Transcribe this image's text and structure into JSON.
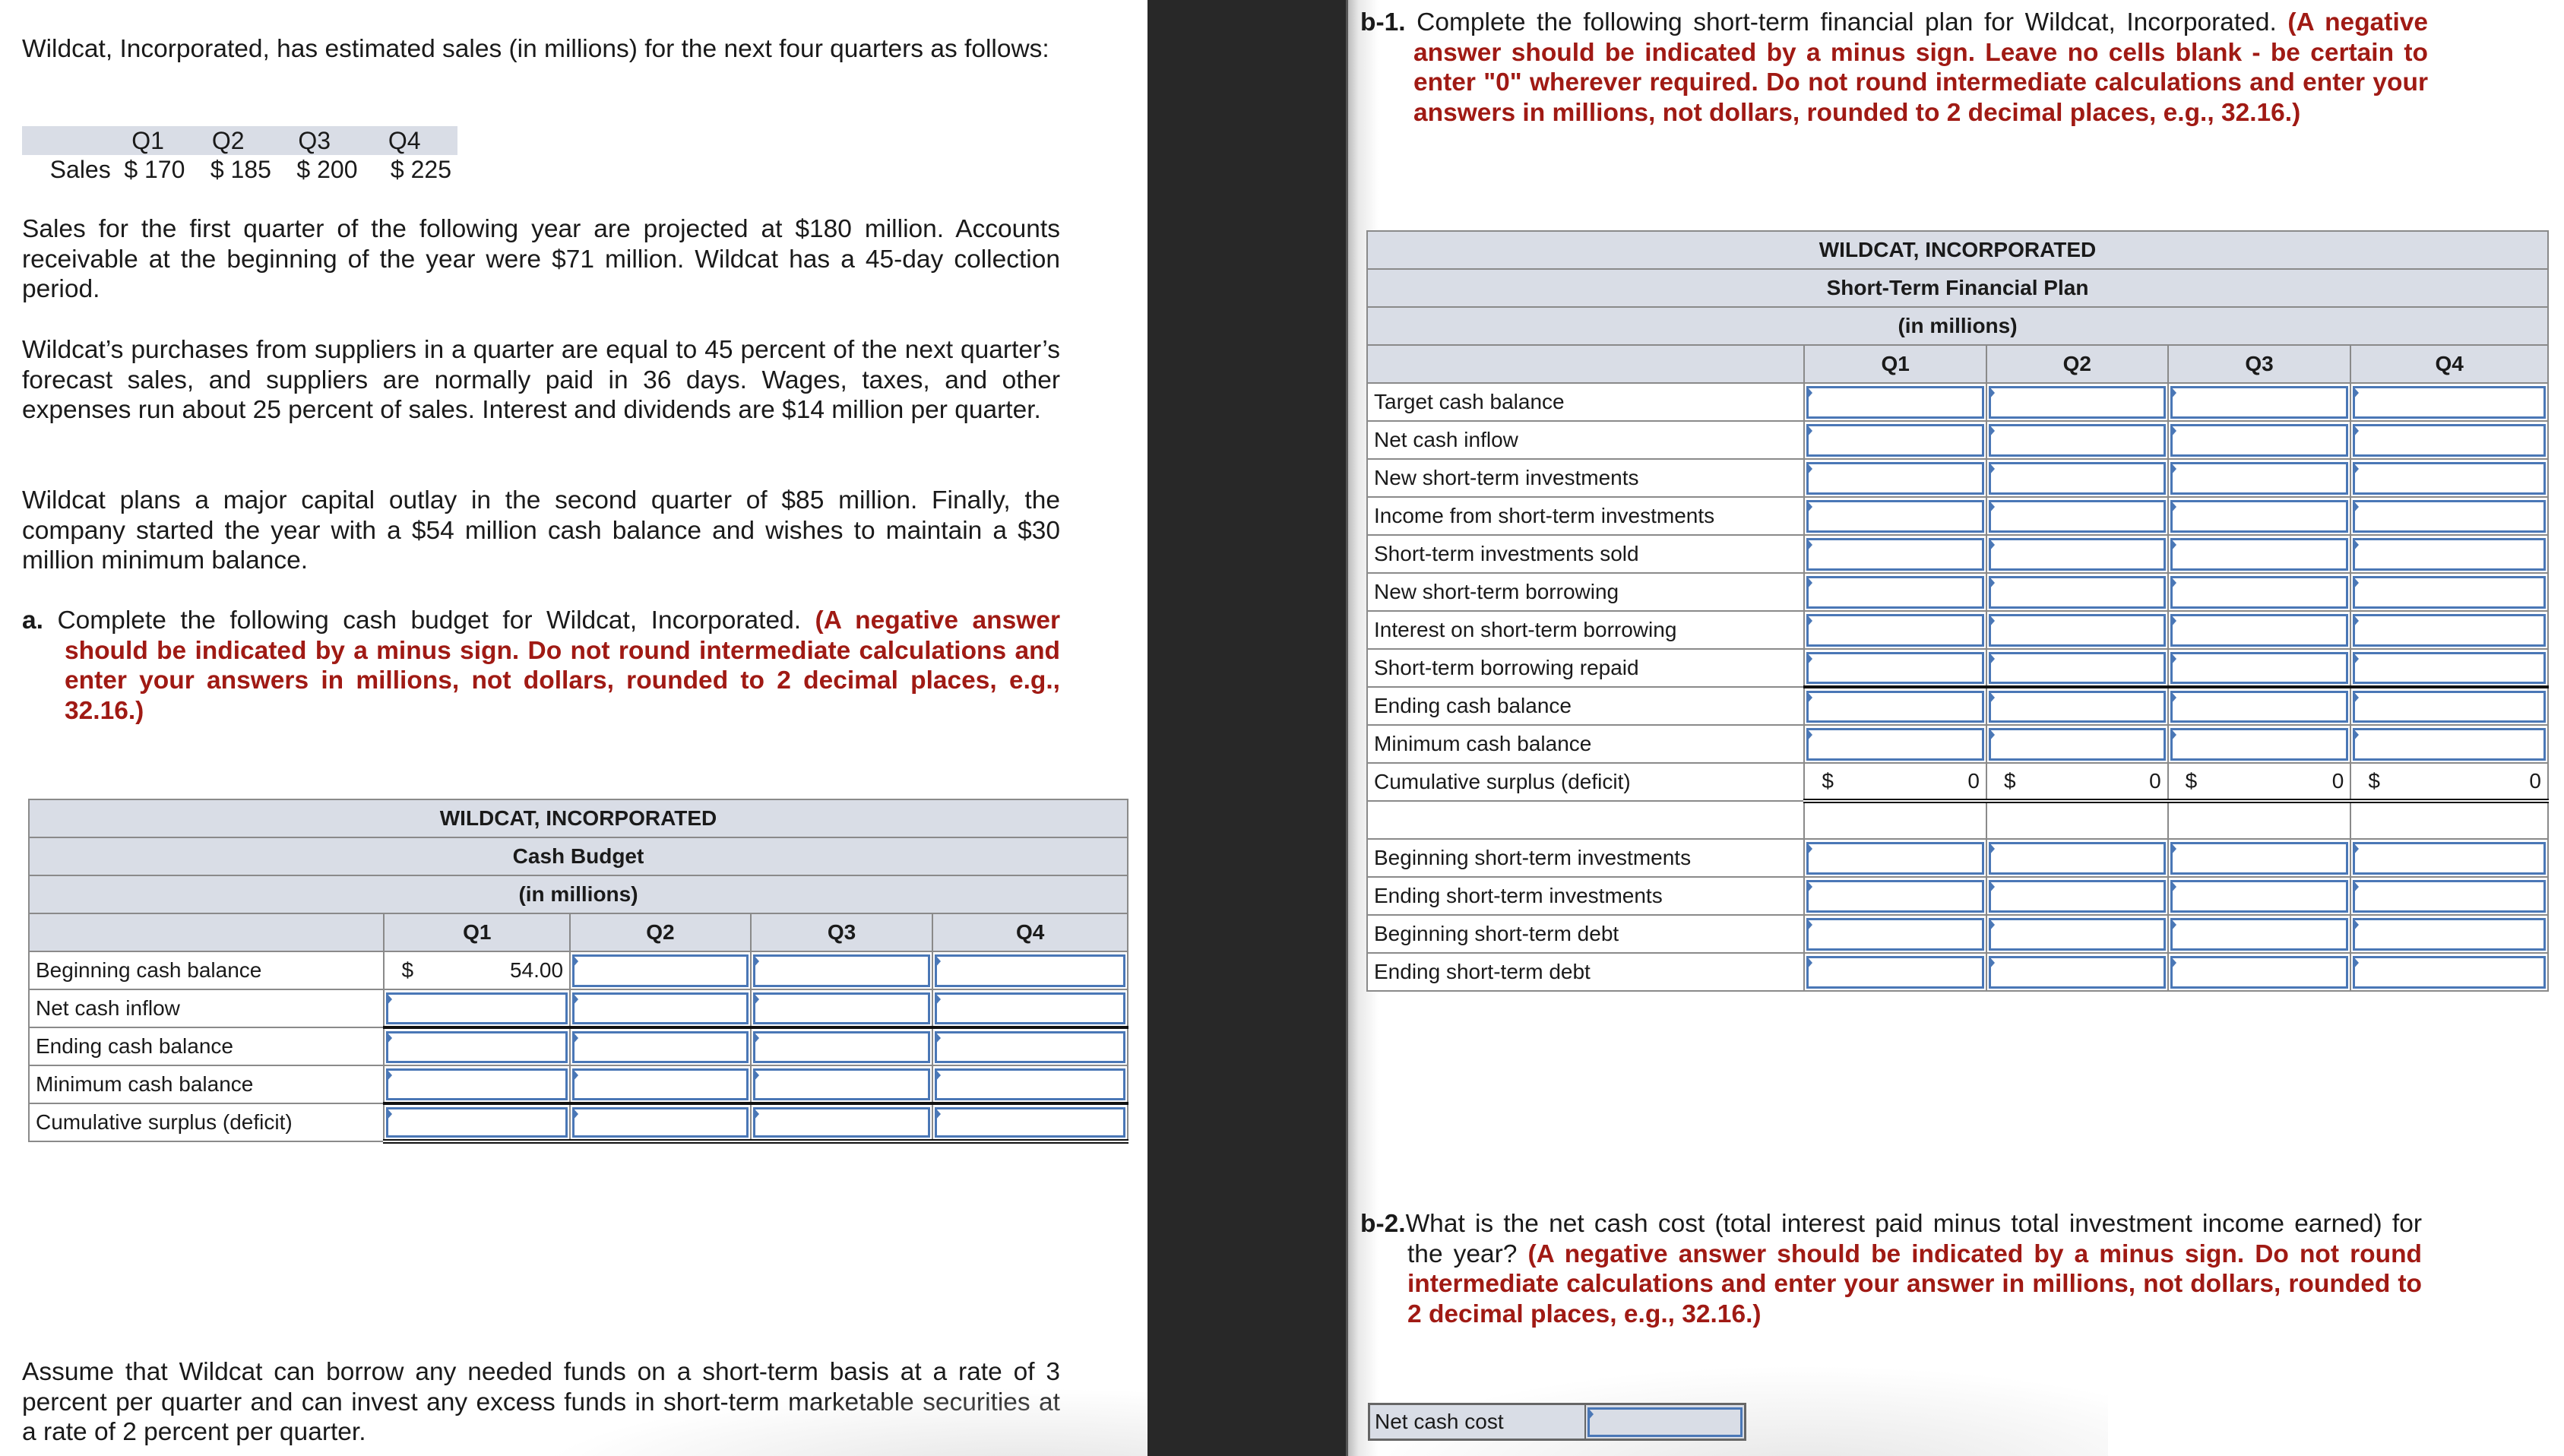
{
  "intro": {
    "p1": "Wildcat, Incorporated, has estimated sales (in millions) for the next four quarters as follows:",
    "p2": "Sales for the first quarter of the following year are projected at $180 million. Accounts receivable at the beginning of the year were $71 million. Wildcat has a 45-day collection period.",
    "p3": "Wildcat’s purchases from suppliers in a quarter are equal to 45 percent of the next quarter’s forecast sales, and suppliers are normally paid in 36 days. Wages, taxes, and other expenses run about 25 percent of sales. Interest and dividends are $14 million per quarter.",
    "p4": "Wildcat plans a major capital outlay in the second quarter of $85 million. Finally, the company started the year with a $54 million cash balance and wishes to maintain a $30 million minimum balance.",
    "p5": "Assume that Wildcat can borrow any needed funds on a short-term basis at a rate of 3 percent per quarter and can invest any excess funds in short-term marketable securities at a rate of 2 percent per quarter."
  },
  "sales_table": {
    "headers": [
      "",
      "Q1",
      "Q2",
      "Q3",
      "Q4"
    ],
    "row_label": "Sales",
    "values": [
      "$ 170",
      "$ 185",
      "$ 200",
      "$ 225"
    ]
  },
  "part_a": {
    "label": "a.",
    "text": "Complete the following cash budget for Wildcat, Incorporated.",
    "instruction": "(A negative answer should be indicated by a minus sign. Do not round intermediate calculations and enter your answers in millions, not dollars, rounded to 2 decimal places, e.g., 32.16.)",
    "table": {
      "title1": "WILDCAT, INCORPORATED",
      "title2": "Cash Budget",
      "title3": "(in millions)",
      "quarters": [
        "Q1",
        "Q2",
        "Q3",
        "Q4"
      ],
      "rows": [
        {
          "label": "Beginning cash balance",
          "prefilled_q1": "54.00",
          "currency": "$"
        },
        {
          "label": "Net cash inflow"
        },
        {
          "label": "Ending cash balance"
        },
        {
          "label": "Minimum cash balance"
        },
        {
          "label": "Cumulative surplus (deficit)"
        }
      ]
    }
  },
  "part_b1": {
    "label": "b-1.",
    "text": "Complete the following short-term financial plan for Wildcat, Incorporated.",
    "instruction": "(A negative answer should be indicated by a minus sign. Leave no cells blank - be certain to enter \"0\" wherever required. Do not round intermediate calculations and enter your answers in millions, not dollars, rounded to 2 decimal places, e.g., 32.16.)",
    "table": {
      "title1": "WILDCAT, INCORPORATED",
      "title2": "Short-Term Financial Plan",
      "title3": "(in millions)",
      "quarters": [
        "Q1",
        "Q2",
        "Q3",
        "Q4"
      ],
      "rows": [
        "Target cash balance",
        "Net cash inflow",
        "New short-term investments",
        "Income from short-term investments",
        "Short-term investments sold",
        "New short-term borrowing",
        "Interest on short-term borrowing",
        "Short-term borrowing repaid",
        "Ending cash balance",
        "Minimum cash balance"
      ],
      "cumulative_row": {
        "label": "Cumulative surplus (deficit)",
        "currency": "$",
        "values": [
          "0",
          "0",
          "0",
          "0"
        ]
      },
      "bottom_rows": [
        "Beginning short-term investments",
        "Ending short-term investments",
        "Beginning short-term debt",
        "Ending short-term debt"
      ]
    }
  },
  "part_b2": {
    "label": "b-2.",
    "text": "What is the net cash cost (total interest paid minus total investment income earned) for the year?",
    "instruction": "(A negative answer should be indicated by a minus sign. Do not round intermediate calculations and enter your answer in millions, not dollars, rounded to 2 decimal places, e.g., 32.16.)",
    "field_label": "Net cash cost"
  }
}
